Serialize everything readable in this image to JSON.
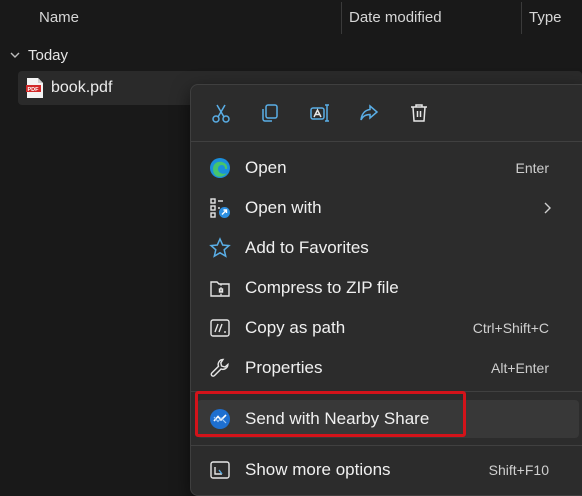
{
  "columns": {
    "name": "Name",
    "date_modified": "Date modified",
    "type": "Type"
  },
  "group": {
    "label": "Today"
  },
  "file": {
    "name": "book.pdf",
    "icon": "pdf-file-icon"
  },
  "toolbar": [
    {
      "name": "cut",
      "icon": "scissors-icon"
    },
    {
      "name": "copy",
      "icon": "copy-icon"
    },
    {
      "name": "rename",
      "icon": "rename-icon"
    },
    {
      "name": "share",
      "icon": "share-icon"
    },
    {
      "name": "delete",
      "icon": "trash-icon"
    }
  ],
  "menu": {
    "items": [
      {
        "label": "Open",
        "shortcut": "Enter",
        "icon": "edge-browser-icon"
      },
      {
        "label": "Open with",
        "shortcut": "",
        "icon": "open-with-icon",
        "submenu": true
      },
      {
        "label": "Add to Favorites",
        "shortcut": "",
        "icon": "star-icon"
      },
      {
        "label": "Compress to ZIP file",
        "shortcut": "",
        "icon": "zip-folder-icon"
      },
      {
        "label": "Copy as path",
        "shortcut": "Ctrl+Shift+C",
        "icon": "copy-path-icon"
      },
      {
        "label": "Properties",
        "shortcut": "Alt+Enter",
        "icon": "wrench-icon"
      },
      {
        "label": "Send with Nearby Share",
        "shortcut": "",
        "icon": "nearby-share-icon",
        "highlighted": true
      },
      {
        "label": "Show more options",
        "shortcut": "Shift+F10",
        "icon": "more-options-icon"
      }
    ]
  },
  "colors": {
    "background": "#191919",
    "menu": "#2c2c2c",
    "accent": "#4aa3e0",
    "highlight_box": "#d3131a"
  }
}
